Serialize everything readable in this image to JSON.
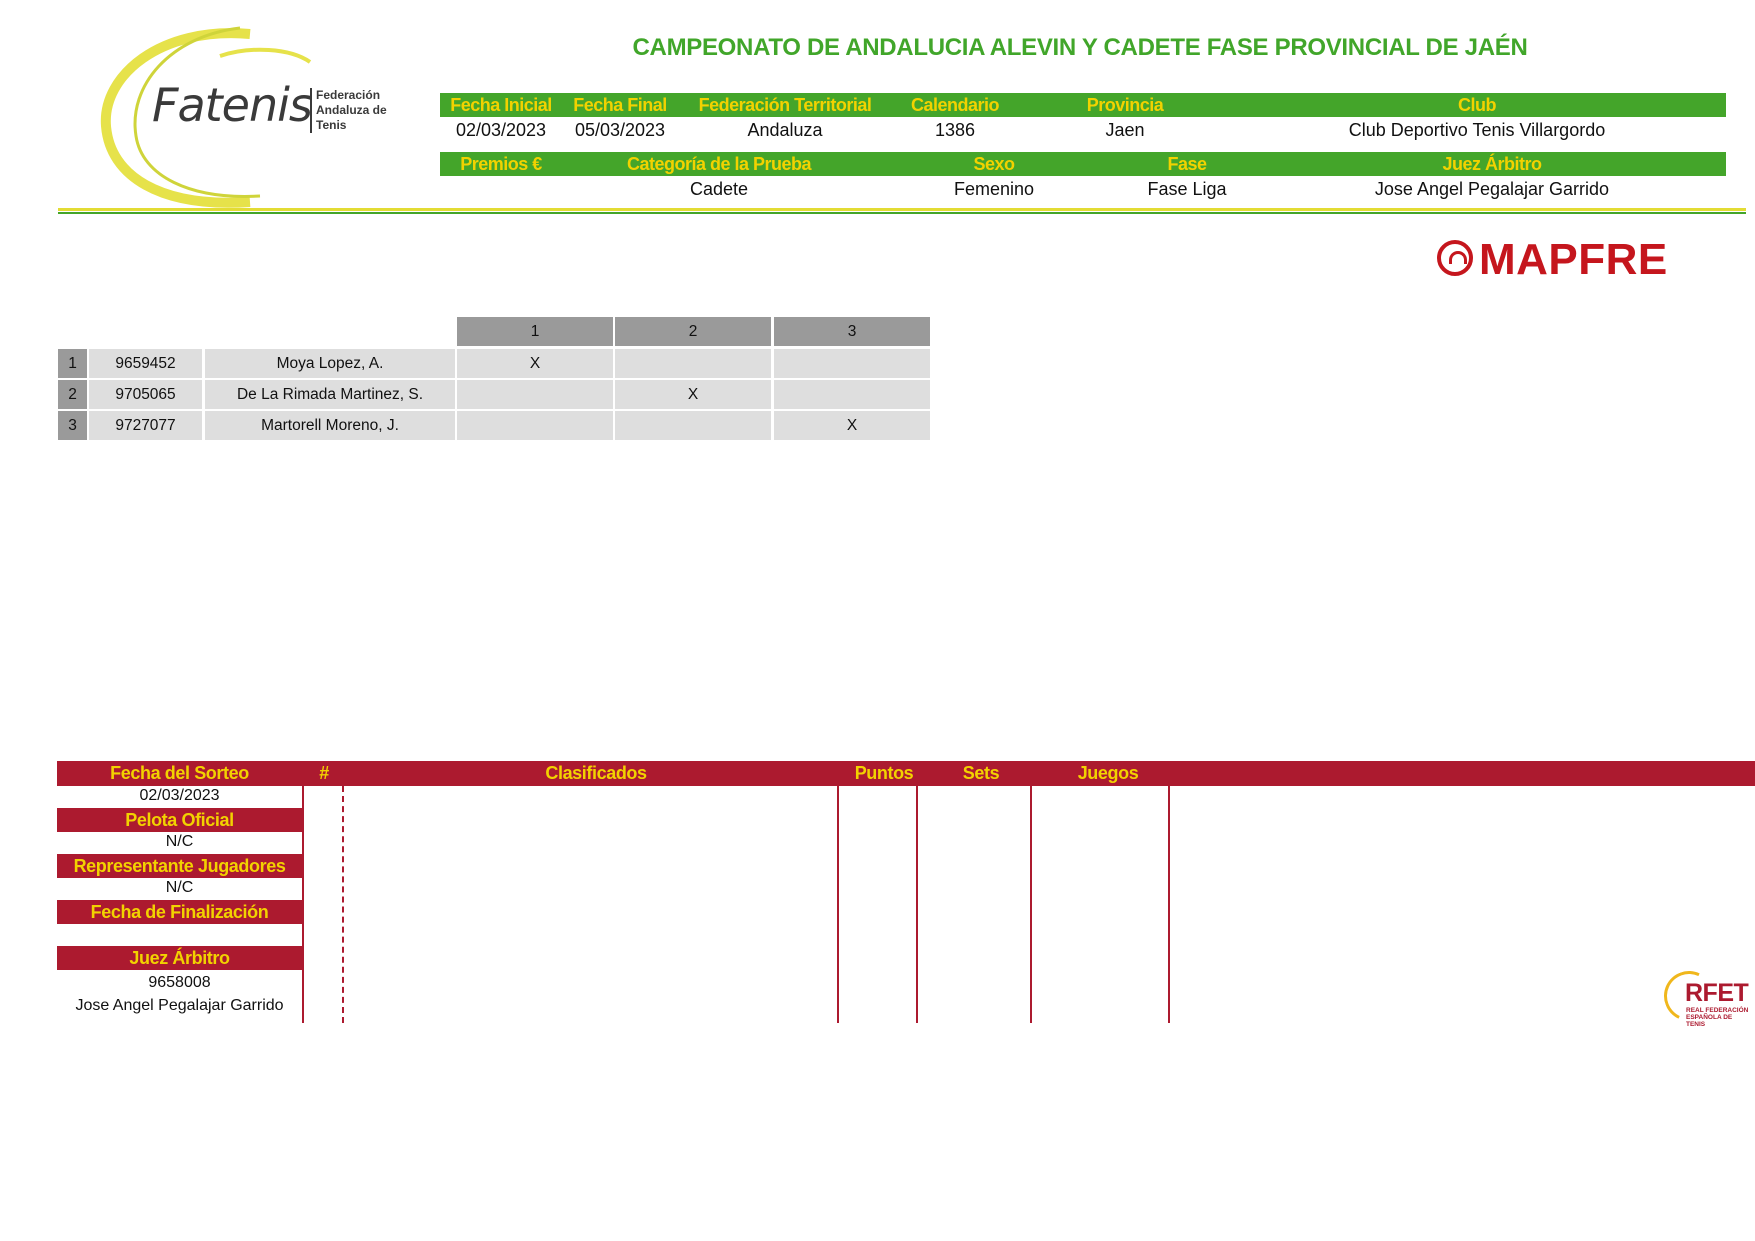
{
  "logo": {
    "word": "Fatenis",
    "sub": [
      "Federación",
      "Andaluza de",
      "Tenis"
    ]
  },
  "title": "CAMPEONATO DE ANDALUCIA ALEVIN Y CADETE FASE PROVINCIAL DE JAÉN",
  "info1": {
    "headers": [
      "Fecha Inicial",
      "Fecha Final",
      "Federación Territorial",
      "Calendario",
      "Provincia",
      "Club"
    ],
    "values": [
      "02/03/2023",
      "05/03/2023",
      "Andaluza",
      "1386",
      "Jaen",
      "Club Deportivo Tenis Villargordo"
    ]
  },
  "info2": {
    "headers": [
      "Premios €",
      "Categoría de la Prueba",
      "Sexo",
      "Fase",
      "Juez Árbitro"
    ],
    "values": [
      "",
      "Cadete",
      "Femenino",
      "Fase Liga",
      "Jose Angel Pegalajar Garrido"
    ]
  },
  "sponsor": "MAPFRE",
  "draw": {
    "columns": [
      "1",
      "2",
      "3"
    ],
    "rows": [
      {
        "num": "1",
        "license": "9659452",
        "name": "Moya Lopez, A.",
        "cells": [
          "X",
          "",
          ""
        ]
      },
      {
        "num": "2",
        "license": "9705065",
        "name": "De La Rimada Martinez, S.",
        "cells": [
          "",
          "X",
          ""
        ]
      },
      {
        "num": "3",
        "license": "9727077",
        "name": "Martorell Moreno, J.",
        "cells": [
          "",
          "",
          "X"
        ]
      }
    ]
  },
  "results": {
    "headers": [
      "Fecha del Sorteo",
      "#",
      "Clasificados",
      "Puntos",
      "Sets",
      "Juegos"
    ],
    "fecha_sorteo": "02/03/2023",
    "pelota_label": "Pelota Oficial",
    "pelota_value": "N/C",
    "representante_label": "Representante Jugadores",
    "representante_value": "N/C",
    "finalizacion_label": "Fecha de Finalización",
    "finalizacion_value": "",
    "juez_label": "Juez Árbitro",
    "juez_id": "9658008",
    "juez_name": "Jose Angel Pegalajar Garrido"
  },
  "rfet": {
    "word": "RFET",
    "sub": [
      "REAL FEDERACIÓN",
      "ESPAÑOLA DE TENIS"
    ]
  },
  "colors": {
    "green": "#44a52a",
    "yellow": "#f2d200",
    "crimson": "#ac1a2f",
    "mapfre_red": "#c5161d",
    "grid_gray": "#dedede",
    "header_gray": "#9a9a9a"
  }
}
